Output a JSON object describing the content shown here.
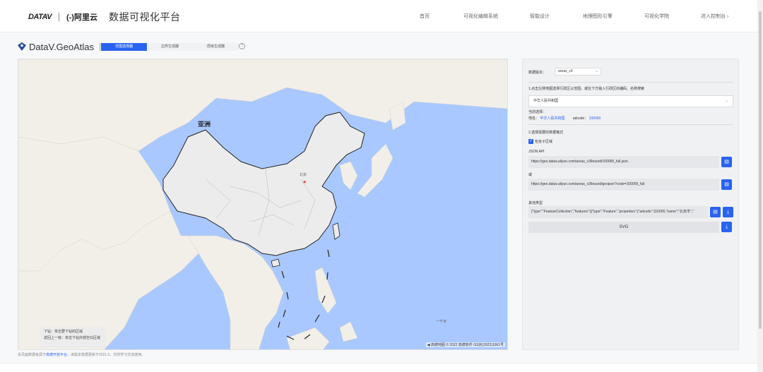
{
  "header": {
    "logo_datav": "DATAV",
    "logo_aliyun": "(-)阿里云",
    "title": "数据可视化平台",
    "nav": [
      "首页",
      "可视化编辑系统",
      "智能设计",
      "地理图形引擎",
      "可视化学院",
      "进入控制台 ›"
    ]
  },
  "subheader": {
    "brand": "DataV.GeoAtlas",
    "tabs": [
      "范围选择器",
      "边界生成器",
      "层级生成器"
    ],
    "help": "?"
  },
  "map": {
    "region_label": "亚洲",
    "capital_label": "北京",
    "scale_label": "一千米",
    "tip_line1": "下钻：单击要下钻的区域",
    "tip_line2": "返回上一级：单击下钻外部空白区域",
    "attribution": "◀ 高德地图 © 2022 高德软件 GS京(2022)1061号",
    "colors": {
      "sea": "#a9c8ff",
      "land": "#f2efe9",
      "china": "#ececec"
    }
  },
  "footnote": {
    "prefix": "本页面数据来源于",
    "link": "高德开放平台",
    "suffix": "，该版本数据更新于2021.5，仅供学习交流使用。"
  },
  "panel": {
    "version_label": "数据版本：",
    "version_value": "areas_v3",
    "step1": "1.点击左侧地图选择行政区以范围，或在下方输入行政区的编码、名称搜索",
    "search_value": "中华人民共和国",
    "current_select_label": "当前选择：",
    "region_label": "地名：",
    "region_value": "中华人民共和国",
    "adcode_label": "adcode：",
    "adcode_value": "100000",
    "step2": "2.选择需要的数据格式",
    "include_sub": "包含子区域",
    "json_api_label": "JSON API",
    "json_api_url": "https://geo.datav.aliyun.com/areas_v3/bound/100000_full.json",
    "alt_label": "或",
    "alt_url": "https://geo.datav.aliyun.com/areas_v3/bound/geojson?code=100000_full",
    "other_label": "其他类型",
    "geojson_preview": "{\"type\":\"FeatureCollection\",\"features\":[{\"type\":\"Feature\",\"properties\":{\"adcode\":110000,\"name\":\"北京市\",\"",
    "svg_label": "SVG"
  }
}
